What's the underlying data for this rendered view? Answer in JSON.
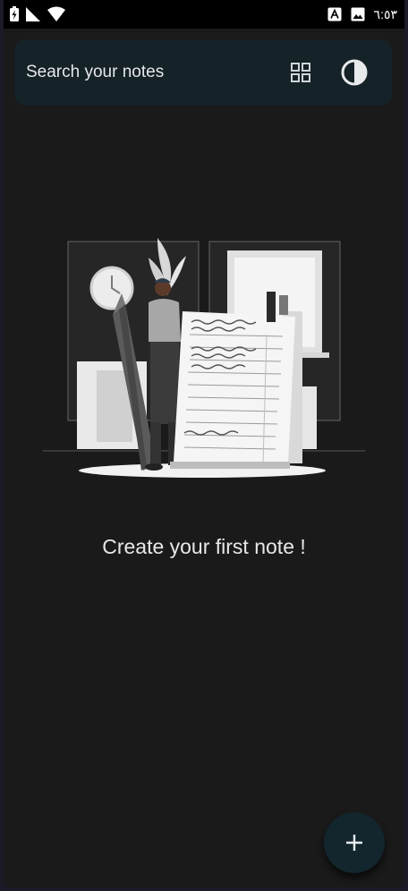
{
  "status_bar": {
    "time": "٦:٥٣",
    "icons": [
      "battery-charging-icon",
      "signal-icon",
      "wifi-icon",
      "keyboard-a-icon",
      "image-icon"
    ]
  },
  "search": {
    "placeholder": "Search your notes",
    "grid_icon": "grid-view-icon",
    "theme_icon": "contrast-theme-icon"
  },
  "empty_state": {
    "illustration": "person-with-pencil-and-note-illustration",
    "message": "Create your first note !"
  },
  "fab": {
    "icon": "plus-icon"
  },
  "colors": {
    "background": "#1a1a1a",
    "search_bar": "#152227",
    "fab": "#13262d",
    "text": "#e8e8e8"
  }
}
